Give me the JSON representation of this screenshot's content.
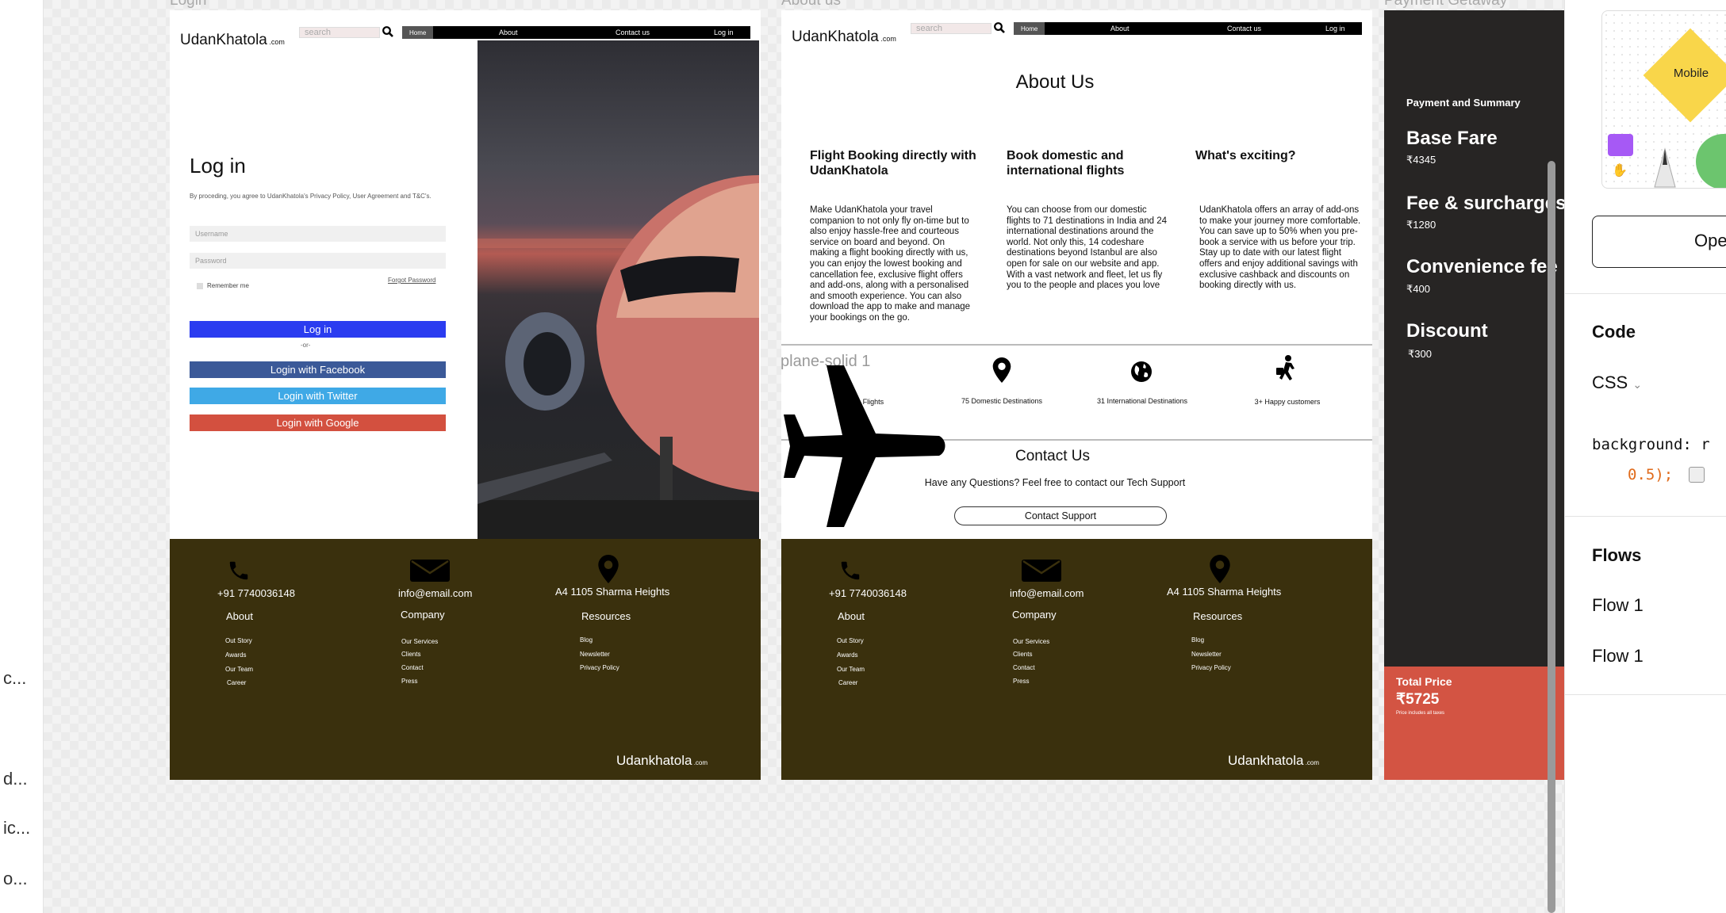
{
  "left_panel": {
    "items": [
      "c...",
      "d...",
      "ic...",
      "o..."
    ]
  },
  "frames": {
    "login": "Login",
    "about": "About us",
    "payment": "Payment Getaway"
  },
  "site": {
    "logo": "UdanKhatola",
    "logo_suffix": ".com",
    "search_placeholder": "search",
    "nav": {
      "home": "Home",
      "about": "About",
      "contact": "Contact us",
      "login": "Log in"
    }
  },
  "login": {
    "title": "Log in",
    "policy": "By proceding, you agree to UdanKhatola's Privacy Policy, User Agreement and T&C's.",
    "username_placeholder": "Username",
    "password_placeholder": "Password",
    "remember": "Remember me",
    "forgot": "Forgot Password",
    "button": "Log in",
    "or": "-or-",
    "facebook": "Login with Facebook",
    "twitter": "Login with Twitter",
    "google": "Login with Google"
  },
  "about": {
    "title": "About Us",
    "columns": [
      {
        "heading": "Flight Booking directly with UdanKhatola",
        "text": "Make UdanKhatola your travel companion to not only fly on-time but to also enjoy hassle-free and courteous service on board and beyond. On making a flight booking directly with us, you can enjoy the lowest booking and cancellation fee, exclusive flight offers and add-ons, along with a personalised and smooth experience. You can also download the app to make and manage your bookings on the go."
      },
      {
        "heading": "Book domestic and international flights",
        "text": "You can choose from our domestic flights to 71 destinations in India and 24 international destinations around the world. Not only this, 14 codeshare destinations beyond Istanbul are also open for sale on our website and app. With a vast network and fleet, let us fly you to the people and places you love"
      },
      {
        "heading": "What's exciting?",
        "text": "UdanKhatola offers an array of add-ons to make your journey more comfortable. You can save up to 50% when you pre-book a service with us before your trip. Stay up to date with our latest flight offers and enjoy additional savings with exclusive cashback and discounts on booking directly with us."
      }
    ],
    "layer_label": "plane-solid 1",
    "stats": [
      "1500+ Flights",
      "75 Domestic Destinations",
      "31 International Destinations",
      "3+ Happy customers"
    ],
    "contact_title": "Contact Us",
    "contact_text": "Have any Questions? Feel free to contact our Tech Support",
    "contact_button": "Contact Support"
  },
  "footer": {
    "phone": "+91 7740036148",
    "email": "info@email.com",
    "address": "A4 1105 Sharma Heights",
    "about_title": "About",
    "about_links": [
      "Out Story",
      "Awards",
      "Our Team",
      "Career"
    ],
    "company_title": "Company",
    "company_links": [
      "Our Services",
      "Clients",
      "Contact",
      "Press"
    ],
    "resources_title": "Resources",
    "resources_links": [
      "Blog",
      "Newsletter",
      "Privacy Policy"
    ],
    "brand": "Udankhatola",
    "brand_suffix": ".com"
  },
  "payment": {
    "summary": "Payment and Summary",
    "base_label": "Base Fare",
    "base": "₹4345",
    "fee_label": "Fee & surcharges",
    "fee": "₹1280",
    "conv_label": "Convenience fee",
    "conv": "₹400",
    "disc_label": "Discount",
    "disc": "₹300",
    "total_label": "Total Price",
    "total": "₹5725",
    "total_note": "Price includes all taxes"
  },
  "right_panel": {
    "component_label": "Mobile",
    "open_button": "Ope",
    "code_title": "Code",
    "css_label": "CSS",
    "code_line1": "background: r",
    "code_line2": "0.5);",
    "flows_title": "Flows",
    "flow1": "Flow 1",
    "flow2": "Flow 1"
  },
  "colors": {
    "footer": "#3a300d",
    "login_blue": "#2b3cf0",
    "facebook": "#3b5998",
    "twitter": "#3fa9e6",
    "google": "#d3503f",
    "pay_bg": "#272524",
    "total_bg": "#d35443",
    "mobile": "#f9d64a"
  }
}
